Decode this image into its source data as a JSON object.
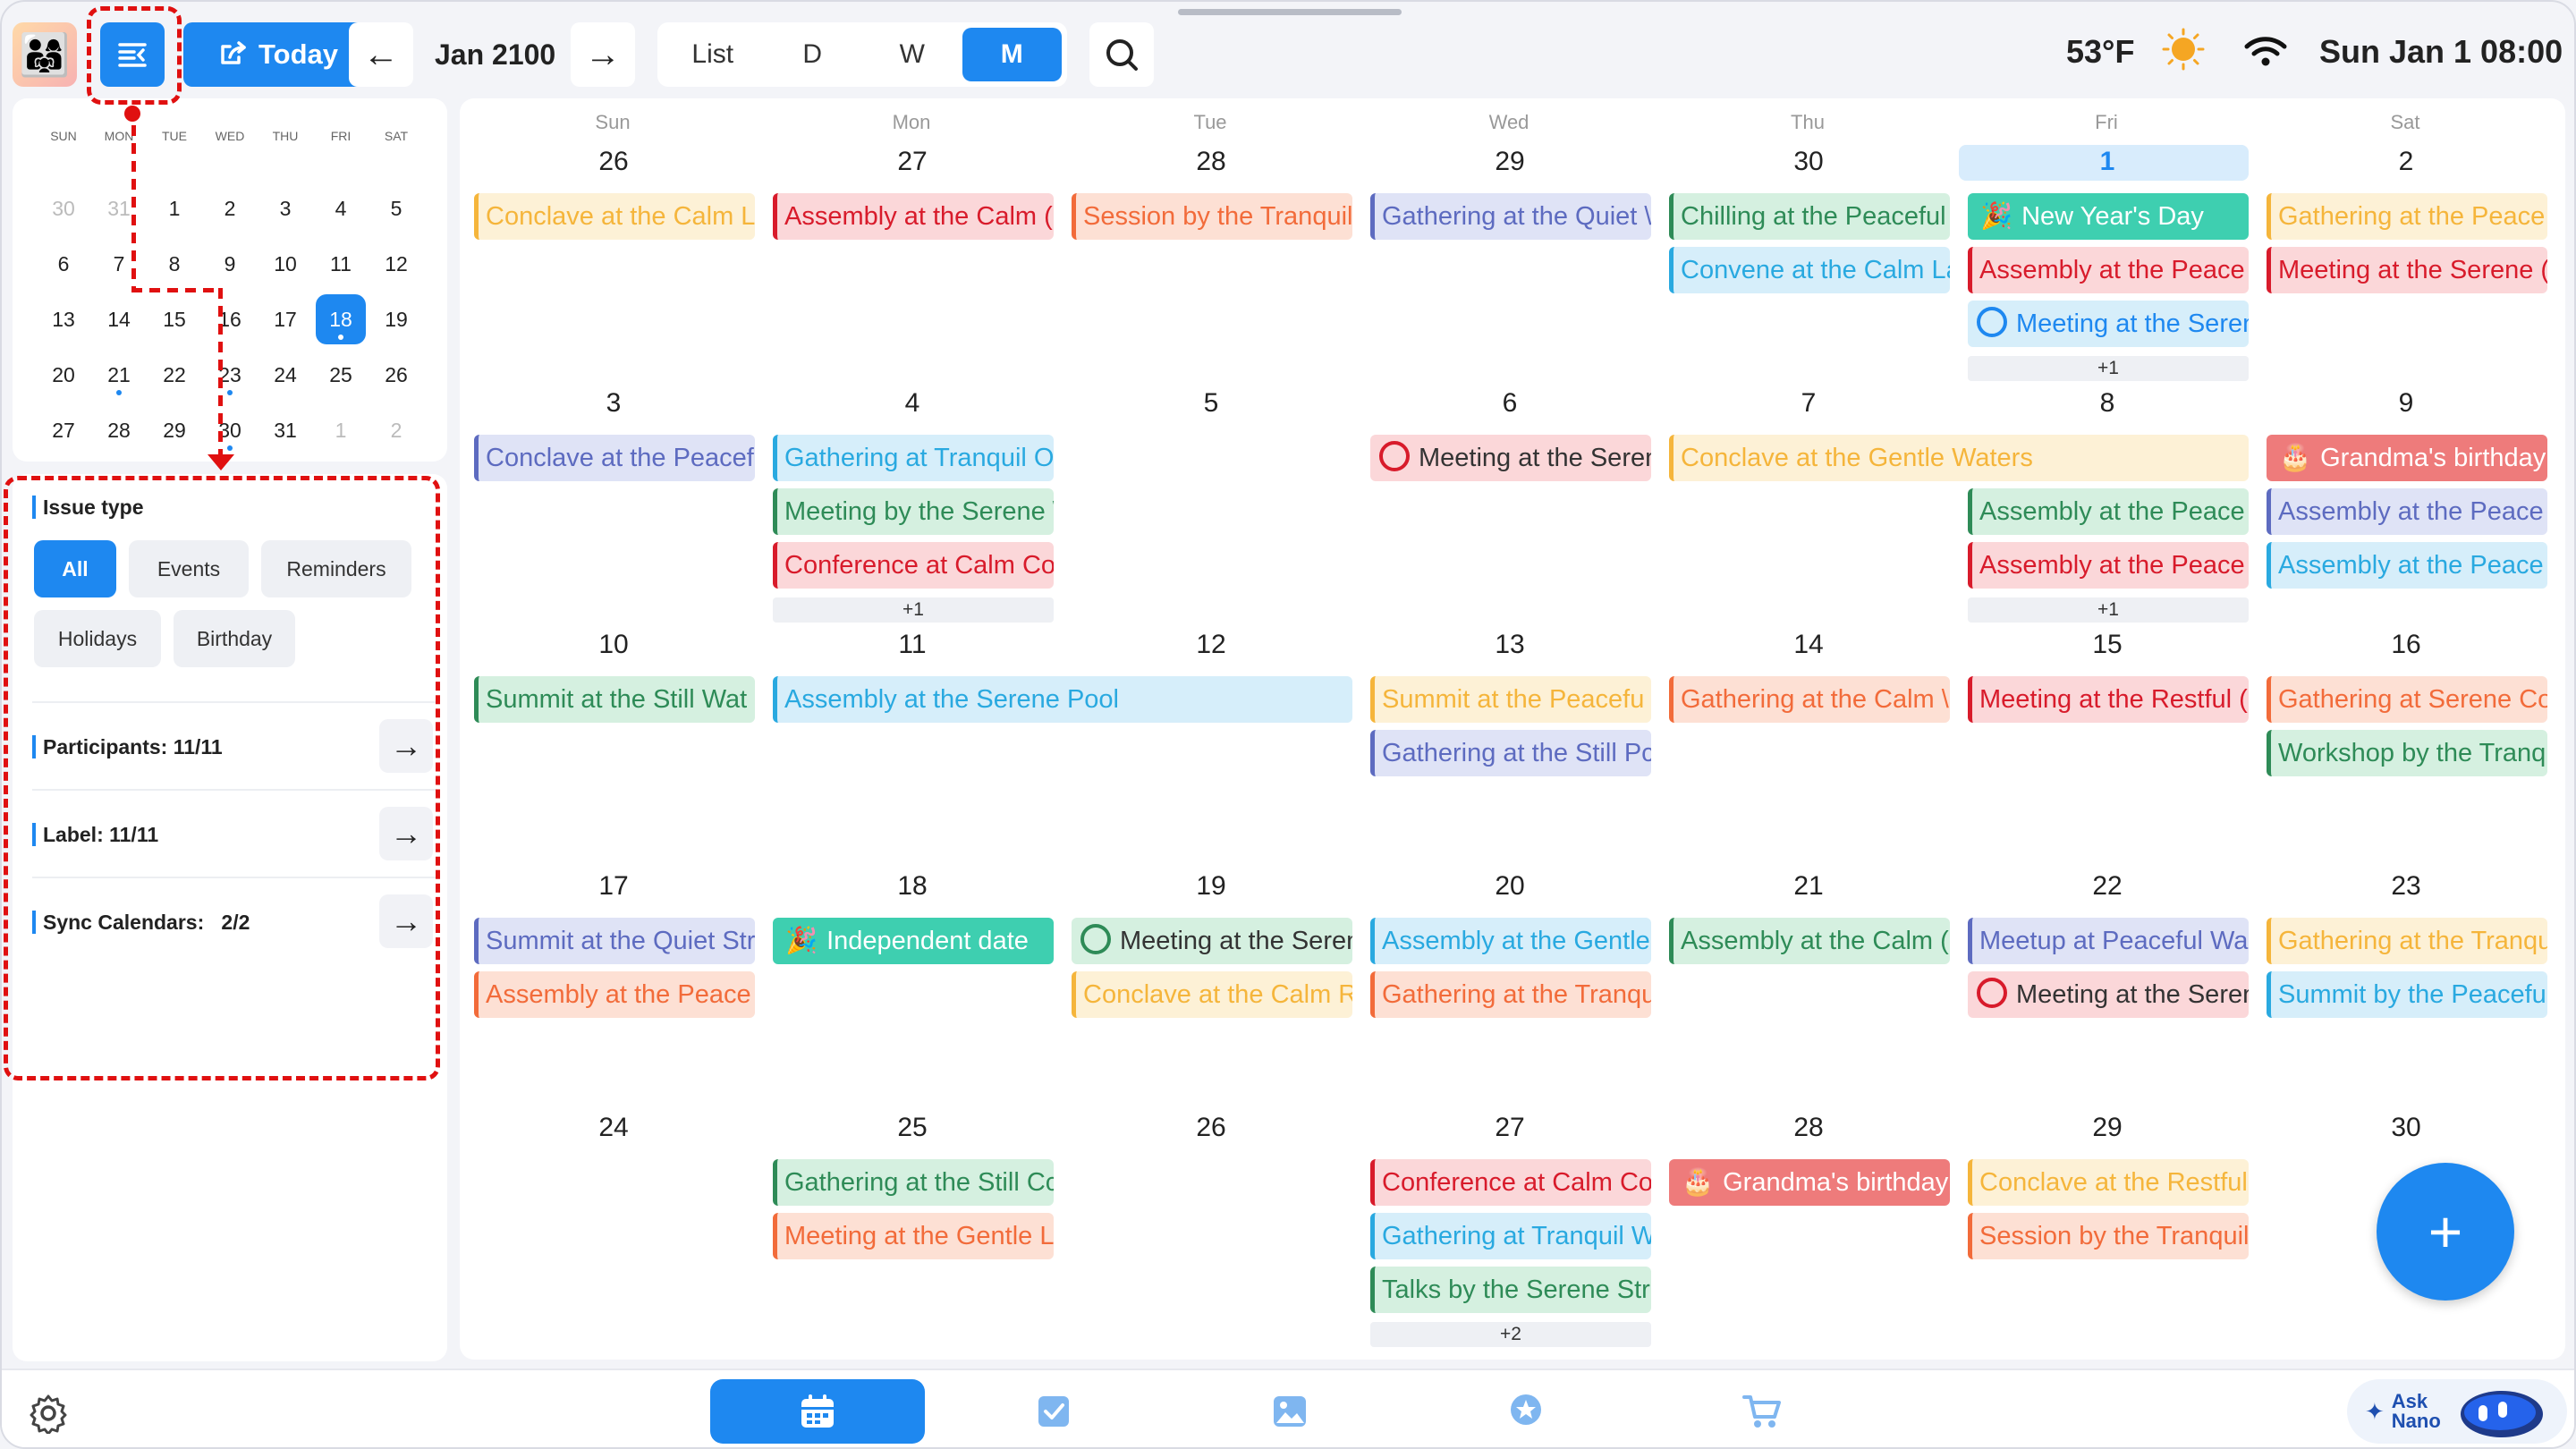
{
  "toolbar": {
    "today_label": "Today",
    "month_label": "Jan 2100",
    "views": [
      "List",
      "D",
      "W",
      "M"
    ],
    "active_view": "M",
    "temperature": "53°F",
    "datetime": "Sun Jan 1 08:00"
  },
  "mini_calendar": {
    "dow": [
      "SUN",
      "MON",
      "TUE",
      "WED",
      "THU",
      "FRI",
      "SAT"
    ],
    "weeks": [
      [
        "30",
        "31",
        "1",
        "2",
        "3",
        "4",
        "5"
      ],
      [
        "6",
        "7",
        "8",
        "9",
        "10",
        "11",
        "12"
      ],
      [
        "13",
        "14",
        "15",
        "16",
        "17",
        "18",
        "19"
      ],
      [
        "20",
        "21",
        "22",
        "23",
        "24",
        "25",
        "26"
      ],
      [
        "27",
        "28",
        "29",
        "30",
        "31",
        "1",
        "2"
      ]
    ],
    "selected": "18"
  },
  "filter": {
    "issue_type_title": "Issue type",
    "chips": [
      "All",
      "Events",
      "Reminders",
      "Holidays",
      "Birthday"
    ],
    "participants": "Participants: 11/11",
    "label": "Label: 11/11",
    "sync": "Sync Calendars:   2/2"
  },
  "calendar": {
    "dow": [
      "Sun",
      "Mon",
      "Tue",
      "Wed",
      "Thu",
      "Fri",
      "Sat"
    ],
    "weeks": [
      [
        "26",
        "27",
        "28",
        "29",
        "30",
        "1",
        "2"
      ],
      [
        "3",
        "4",
        "5",
        "6",
        "7",
        "8",
        "9"
      ],
      [
        "10",
        "11",
        "12",
        "13",
        "14",
        "15",
        "16"
      ],
      [
        "17",
        "18",
        "19",
        "20",
        "21",
        "22",
        "23"
      ],
      [
        "24",
        "25",
        "26",
        "27",
        "28",
        "29",
        "30"
      ]
    ],
    "events": [
      {
        "w": 0,
        "d": 0,
        "slot": 0,
        "span": 1,
        "title": "Conclave at the Calm L",
        "color": "#f5b53b",
        "bg": "#fdf1d6"
      },
      {
        "w": 0,
        "d": 1,
        "slot": 0,
        "span": 1,
        "title": "Assembly at the Calm (",
        "color": "#d81b2b",
        "bg": "#fbd7d9"
      },
      {
        "w": 0,
        "d": 2,
        "slot": 0,
        "span": 1,
        "title": "Session by the Tranquil",
        "color": "#f26b3a",
        "bg": "#fde0d4"
      },
      {
        "w": 0,
        "d": 3,
        "slot": 0,
        "span": 1,
        "title": "Gathering at the Quiet \\",
        "color": "#5d6bc0",
        "bg": "#dfe3f6"
      },
      {
        "w": 0,
        "d": 4,
        "slot": 0,
        "span": 1,
        "title": "Chilling at the Peaceful",
        "color": "#2e8b57",
        "bg": "#d5f0e0"
      },
      {
        "w": 0,
        "d": 5,
        "slot": 0,
        "span": 1,
        "title": "New Year's Day",
        "color": "#3ecfb0",
        "bg": "#3ecfb0",
        "style": "solid",
        "icon": "🎉"
      },
      {
        "w": 0,
        "d": 6,
        "slot": 0,
        "span": 1,
        "title": "Gathering at the Peace",
        "color": "#f5b53b",
        "bg": "#fdf1d6"
      },
      {
        "w": 0,
        "d": 4,
        "slot": 1,
        "span": 1,
        "title": "Convene at the Calm La",
        "color": "#29a9e0",
        "bg": "#d6eefa"
      },
      {
        "w": 0,
        "d": 5,
        "slot": 1,
        "span": 1,
        "title": "Assembly at the Peace",
        "color": "#d81b2b",
        "bg": "#fbd7d9"
      },
      {
        "w": 0,
        "d": 6,
        "slot": 1,
        "span": 1,
        "title": "Meeting at the Serene (",
        "color": "#d81b2b",
        "bg": "#fbd7d9"
      },
      {
        "w": 0,
        "d": 5,
        "slot": 2,
        "span": 1,
        "title": "Meeting at the Seren",
        "color": "#1e88f0",
        "bg": "#d6eefa",
        "style": "ring"
      },
      {
        "w": 1,
        "d": 0,
        "slot": 0,
        "span": 1,
        "title": "Conclave at the Peacef",
        "color": "#5d6bc0",
        "bg": "#dfe3f6"
      },
      {
        "w": 1,
        "d": 1,
        "slot": 0,
        "span": 1,
        "title": "Gathering at Tranquil O",
        "color": "#29a9e0",
        "bg": "#d6eefa"
      },
      {
        "w": 1,
        "d": 3,
        "slot": 0,
        "span": 1,
        "title": "Meeting at the Seren",
        "color": "#d81b2b",
        "bg": "#fbd7d9",
        "style": "ring"
      },
      {
        "w": 1,
        "d": 4,
        "slot": 0,
        "span": 2,
        "title": "Conclave at the Gentle Waters",
        "color": "#f5b53b",
        "bg": "#fdf1d6"
      },
      {
        "w": 1,
        "d": 6,
        "slot": 0,
        "span": 1,
        "title": "Grandma's birthday",
        "color": "#ee7b7b",
        "bg": "#ee7b7b",
        "style": "solid",
        "icon": "🎂"
      },
      {
        "w": 1,
        "d": 1,
        "slot": 1,
        "span": 1,
        "title": "Meeting by the Serene \\",
        "color": "#2e8b57",
        "bg": "#d5f0e0"
      },
      {
        "w": 1,
        "d": 5,
        "slot": 1,
        "span": 1,
        "title": "Assembly at the Peace",
        "color": "#2e8b57",
        "bg": "#d5f0e0"
      },
      {
        "w": 1,
        "d": 6,
        "slot": 1,
        "span": 1,
        "title": "Assembly at the Peace",
        "color": "#5d6bc0",
        "bg": "#dfe3f6"
      },
      {
        "w": 1,
        "d": 1,
        "slot": 2,
        "span": 1,
        "title": "Conference at Calm Co",
        "color": "#d81b2b",
        "bg": "#fbd7d9"
      },
      {
        "w": 1,
        "d": 5,
        "slot": 2,
        "span": 1,
        "title": "Assembly at the Peace",
        "color": "#d81b2b",
        "bg": "#fbd7d9"
      },
      {
        "w": 1,
        "d": 6,
        "slot": 2,
        "span": 1,
        "title": "Assembly at the Peace",
        "color": "#29a9e0",
        "bg": "#d6eefa"
      },
      {
        "w": 2,
        "d": 0,
        "slot": 0,
        "span": 1,
        "title": "Summit at the Still Wat",
        "color": "#2e8b57",
        "bg": "#d5f0e0"
      },
      {
        "w": 2,
        "d": 1,
        "slot": 0,
        "span": 2,
        "title": "Assembly at the Serene Pool",
        "color": "#29a9e0",
        "bg": "#d6eefa"
      },
      {
        "w": 2,
        "d": 3,
        "slot": 0,
        "span": 1,
        "title": "Summit at the Peacefu",
        "color": "#f5b53b",
        "bg": "#fdf1d6"
      },
      {
        "w": 2,
        "d": 4,
        "slot": 0,
        "span": 1,
        "title": "Gathering at the Calm \\",
        "color": "#f26b3a",
        "bg": "#fde0d4"
      },
      {
        "w": 2,
        "d": 5,
        "slot": 0,
        "span": 1,
        "title": "Meeting at the Restful (",
        "color": "#d81b2b",
        "bg": "#fbd7d9"
      },
      {
        "w": 2,
        "d": 6,
        "slot": 0,
        "span": 1,
        "title": "Gathering at Serene Co",
        "color": "#f26b3a",
        "bg": "#fde0d4"
      },
      {
        "w": 2,
        "d": 3,
        "slot": 1,
        "span": 1,
        "title": "Gathering at the Still Pc",
        "color": "#5d6bc0",
        "bg": "#dfe3f6"
      },
      {
        "w": 2,
        "d": 6,
        "slot": 1,
        "span": 1,
        "title": "Workshop by the Tranq",
        "color": "#2e8b57",
        "bg": "#d5f0e0"
      },
      {
        "w": 3,
        "d": 0,
        "slot": 0,
        "span": 1,
        "title": "Summit at the Quiet Str",
        "color": "#5d6bc0",
        "bg": "#dfe3f6"
      },
      {
        "w": 3,
        "d": 1,
        "slot": 0,
        "span": 1,
        "title": "Independent date",
        "color": "#3ecfb0",
        "bg": "#3ecfb0",
        "style": "solid",
        "icon": "🎉"
      },
      {
        "w": 3,
        "d": 2,
        "slot": 0,
        "span": 1,
        "title": "Meeting at the Seren",
        "color": "#2e8b57",
        "bg": "#d5f0e0",
        "style": "ring"
      },
      {
        "w": 3,
        "d": 3,
        "slot": 0,
        "span": 1,
        "title": "Assembly at the Gentle",
        "color": "#29a9e0",
        "bg": "#d6eefa"
      },
      {
        "w": 3,
        "d": 4,
        "slot": 0,
        "span": 1,
        "title": "Assembly at the Calm (",
        "color": "#2e8b57",
        "bg": "#d5f0e0"
      },
      {
        "w": 3,
        "d": 5,
        "slot": 0,
        "span": 1,
        "title": "Meetup at Peaceful Wa",
        "color": "#5d6bc0",
        "bg": "#dfe3f6"
      },
      {
        "w": 3,
        "d": 6,
        "slot": 0,
        "span": 1,
        "title": "Gathering at the Tranqu",
        "color": "#f5b53b",
        "bg": "#fdf1d6"
      },
      {
        "w": 3,
        "d": 0,
        "slot": 1,
        "span": 1,
        "title": "Assembly at the Peace",
        "color": "#f26b3a",
        "bg": "#fde0d4"
      },
      {
        "w": 3,
        "d": 2,
        "slot": 1,
        "span": 1,
        "title": "Conclave at the Calm R",
        "color": "#f5b53b",
        "bg": "#fdf1d6"
      },
      {
        "w": 3,
        "d": 3,
        "slot": 1,
        "span": 1,
        "title": "Gathering at the Tranqu",
        "color": "#f26b3a",
        "bg": "#fde0d4"
      },
      {
        "w": 3,
        "d": 5,
        "slot": 1,
        "span": 1,
        "title": "Meeting at the Seren",
        "color": "#d81b2b",
        "bg": "#fbd7d9",
        "style": "ring"
      },
      {
        "w": 3,
        "d": 6,
        "slot": 1,
        "span": 1,
        "title": "Summit by the Peacefu",
        "color": "#29a9e0",
        "bg": "#d6eefa"
      },
      {
        "w": 4,
        "d": 1,
        "slot": 0,
        "span": 1,
        "title": "Gathering at the Still Cc",
        "color": "#2e8b57",
        "bg": "#d5f0e0"
      },
      {
        "w": 4,
        "d": 3,
        "slot": 0,
        "span": 1,
        "title": "Conference at Calm Co",
        "color": "#d81b2b",
        "bg": "#fbd7d9"
      },
      {
        "w": 4,
        "d": 4,
        "slot": 0,
        "span": 1,
        "title": "Grandma's birthday",
        "color": "#ee7b7b",
        "bg": "#ee7b7b",
        "style": "solid",
        "icon": "🎂"
      },
      {
        "w": 4,
        "d": 5,
        "slot": 0,
        "span": 1,
        "title": "Conclave at the Restful",
        "color": "#f5b53b",
        "bg": "#fdf1d6"
      },
      {
        "w": 4,
        "d": 1,
        "slot": 1,
        "span": 1,
        "title": "Meeting at the Gentle L",
        "color": "#f26b3a",
        "bg": "#fde0d4"
      },
      {
        "w": 4,
        "d": 3,
        "slot": 1,
        "span": 1,
        "title": "Gathering at Tranquil W",
        "color": "#29a9e0",
        "bg": "#d6eefa"
      },
      {
        "w": 4,
        "d": 5,
        "slot": 1,
        "span": 1,
        "title": "Session by the Tranquil",
        "color": "#f26b3a",
        "bg": "#fde0d4"
      },
      {
        "w": 4,
        "d": 3,
        "slot": 2,
        "span": 1,
        "title": "Talks by the Serene Stre",
        "color": "#2e8b57",
        "bg": "#d5f0e0"
      }
    ],
    "more": [
      {
        "w": 0,
        "d": 5,
        "label": "+1"
      },
      {
        "w": 1,
        "d": 1,
        "label": "+1"
      },
      {
        "w": 1,
        "d": 5,
        "label": "+1"
      },
      {
        "w": 4,
        "d": 3,
        "label": "+2"
      }
    ]
  },
  "bottom_nav": [
    "calendar-icon",
    "tasks-icon",
    "photos-icon",
    "rewards-icon",
    "cart-icon"
  ],
  "ask": {
    "line1": "Ask",
    "line2": "Nano"
  },
  "colors": {
    "accent": "#1e88f0",
    "annotation": "#e01010"
  }
}
